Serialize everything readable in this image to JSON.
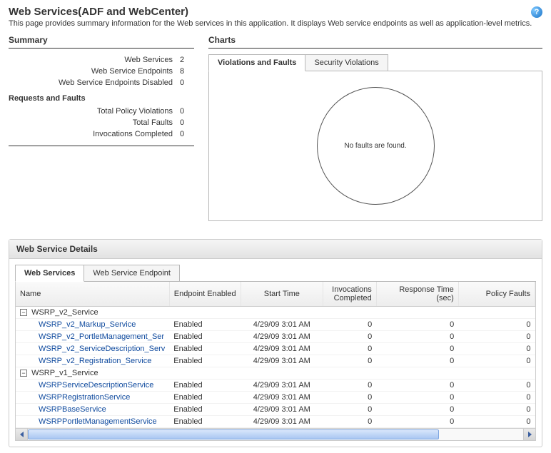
{
  "page": {
    "title": "Web Services(ADF and WebCenter)",
    "description": "This page provides summary information for the Web services in this application. It displays Web service endpoints as well as application-level metrics."
  },
  "summary": {
    "heading": "Summary",
    "stats": {
      "web_services_label": "Web Services",
      "web_services_value": "2",
      "endpoints_label": "Web Service Endpoints",
      "endpoints_value": "8",
      "disabled_label": "Web Service Endpoints Disabled",
      "disabled_value": "0"
    },
    "faults_heading": "Requests and Faults",
    "faults": {
      "policy_label": "Total Policy Violations",
      "policy_value": "0",
      "faults_label": "Total Faults",
      "faults_value": "0",
      "invocations_label": "Invocations Completed",
      "invocations_value": "0"
    }
  },
  "charts": {
    "heading": "Charts",
    "tabs": {
      "violations": "Violations and Faults",
      "security": "Security Violations"
    },
    "empty_text": "No faults are found."
  },
  "chart_data": {
    "type": "pie",
    "title": "Violations and Faults",
    "categories": [],
    "values": [],
    "empty": true,
    "empty_message": "No faults are found."
  },
  "details": {
    "heading": "Web Service Details",
    "tabs": {
      "web_services": "Web Services",
      "endpoint": "Web Service Endpoint"
    },
    "columns": {
      "name": "Name",
      "endpoint_enabled": "Endpoint Enabled",
      "start_time": "Start Time",
      "invocations": "Invocations Completed",
      "response_time": "Response Time (sec)",
      "policy_faults": "Policy Faults"
    },
    "groups": [
      {
        "name": "WSRP_v2_Service",
        "rows": [
          {
            "name": "WSRP_v2_Markup_Service",
            "enabled": "Enabled",
            "start": "4/29/09 3:01 AM",
            "inv": "0",
            "rt": "0",
            "pf": "0"
          },
          {
            "name": "WSRP_v2_PortletManagement_Ser",
            "enabled": "Enabled",
            "start": "4/29/09 3:01 AM",
            "inv": "0",
            "rt": "0",
            "pf": "0"
          },
          {
            "name": "WSRP_v2_ServiceDescription_Serv",
            "enabled": "Enabled",
            "start": "4/29/09 3:01 AM",
            "inv": "0",
            "rt": "0",
            "pf": "0"
          },
          {
            "name": "WSRP_v2_Registration_Service",
            "enabled": "Enabled",
            "start": "4/29/09 3:01 AM",
            "inv": "0",
            "rt": "0",
            "pf": "0"
          }
        ]
      },
      {
        "name": "WSRP_v1_Service",
        "rows": [
          {
            "name": "WSRPServiceDescriptionService",
            "enabled": "Enabled",
            "start": "4/29/09 3:01 AM",
            "inv": "0",
            "rt": "0",
            "pf": "0"
          },
          {
            "name": "WSRPRegistrationService",
            "enabled": "Enabled",
            "start": "4/29/09 3:01 AM",
            "inv": "0",
            "rt": "0",
            "pf": "0"
          },
          {
            "name": "WSRPBaseService",
            "enabled": "Enabled",
            "start": "4/29/09 3:01 AM",
            "inv": "0",
            "rt": "0",
            "pf": "0"
          },
          {
            "name": "WSRPPortletManagementService",
            "enabled": "Enabled",
            "start": "4/29/09 3:01 AM",
            "inv": "0",
            "rt": "0",
            "pf": "0"
          }
        ]
      }
    ]
  }
}
